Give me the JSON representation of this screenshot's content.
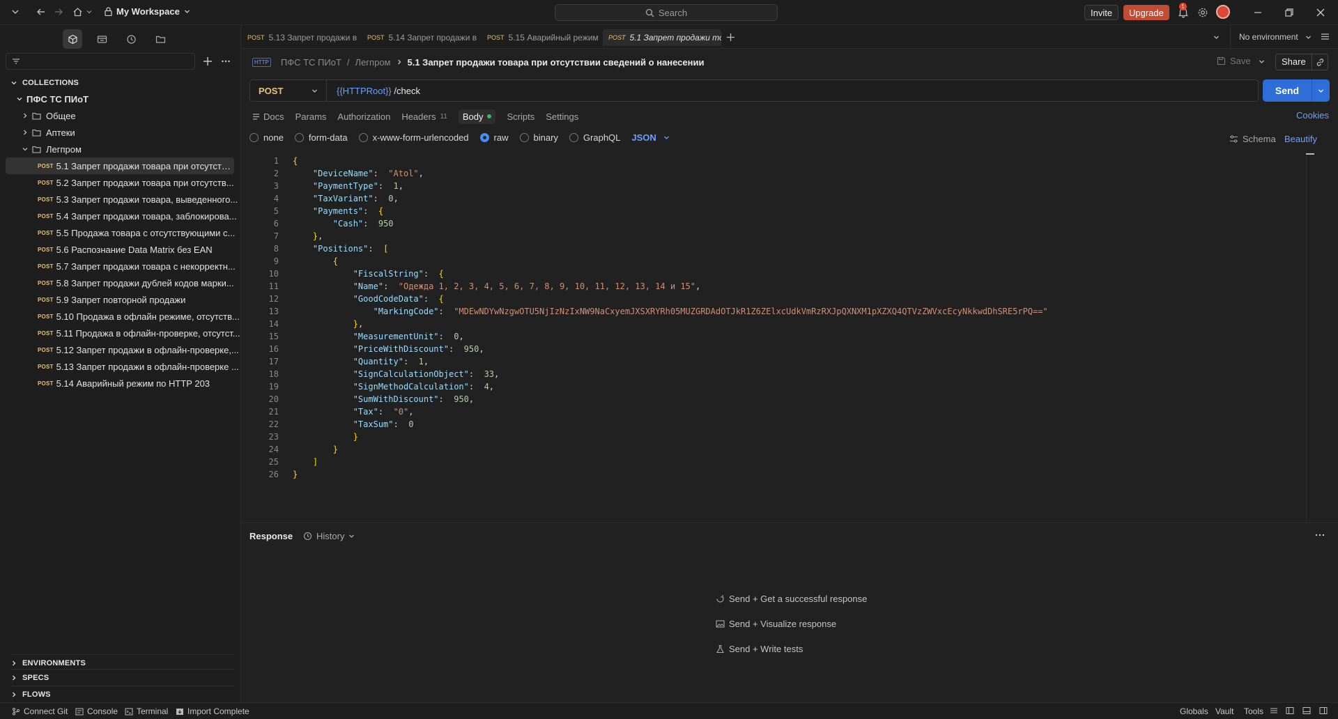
{
  "titlebar": {
    "workspace": "My Workspace",
    "search_placeholder": "Search",
    "invite": "Invite",
    "upgrade": "Upgrade",
    "notification_count": "1"
  },
  "sidebar": {
    "collections_label": "COLLECTIONS",
    "root": "ПФС ТС ПИоТ",
    "folders": [
      "Общее",
      "Аптеки",
      "Легпром"
    ],
    "requests": [
      {
        "method": "POST",
        "label": "5.1 Запрет продажи товара при отсутстви..."
      },
      {
        "method": "POST",
        "label": "5.2 Запрет продажи товара при отсутств..."
      },
      {
        "method": "POST",
        "label": "5.3 Запрет продажи товара, выведенного..."
      },
      {
        "method": "POST",
        "label": "5.4 Запрет продажи товара, заблокирова..."
      },
      {
        "method": "POST",
        "label": "5.5 Продажа товара с отсутствующими с..."
      },
      {
        "method": "POST",
        "label": "5.6 Распознание Data Matrix без EAN"
      },
      {
        "method": "POST",
        "label": "5.7 Запрет продажи товара с некорректн..."
      },
      {
        "method": "POST",
        "label": "5.8 Запрет продажи дублей кодов марки..."
      },
      {
        "method": "POST",
        "label": "5.9 Запрет повторной продажи"
      },
      {
        "method": "POST",
        "label": "5.10 Продажа в офлайн режиме, отсутств..."
      },
      {
        "method": "POST",
        "label": "5.11 Продажа в офлайн-проверке, отсутст..."
      },
      {
        "method": "POST",
        "label": "5.12 Запрет продажи в офлайн-проверке,..."
      },
      {
        "method": "POST",
        "label": "5.13 Запрет продажи в офлайн-проверке ..."
      },
      {
        "method": "POST",
        "label": "5.14 Аварийный режим по HTTP 203"
      }
    ],
    "environments_label": "ENVIRONMENTS",
    "specs_label": "SPECS",
    "flows_label": "FLOWS"
  },
  "tabs": [
    {
      "method": "POST",
      "label": "5.13 Запрет продажи в"
    },
    {
      "method": "POST",
      "label": "5.14 Запрет продажи в"
    },
    {
      "method": "POST",
      "label": "5.15 Аварийный режим"
    },
    {
      "method": "POST",
      "label": "5.1 Запрет продажи то"
    }
  ],
  "environment": "No environment",
  "request": {
    "crumb_icon": "HTTP",
    "crumb_collection": "ПФС ТС ПИоТ",
    "crumb_folder": "Легпром",
    "crumb_title": "5.1 Запрет продажи товара при отсутствии сведений о нанесении",
    "save_label": "Save",
    "share_label": "Share",
    "method": "POST",
    "url_var": "{{HTTPRoot}}",
    "url_path": " /check",
    "send_label": "Send",
    "tabs": {
      "docs": "Docs",
      "params": "Params",
      "auth": "Authorization",
      "headers": "Headers",
      "headers_count": "11",
      "body": "Body",
      "scripts": "Scripts",
      "settings": "Settings"
    },
    "cookies": "Cookies",
    "body_types": [
      "none",
      "form-data",
      "x-www-form-urlencoded",
      "raw",
      "binary",
      "GraphQL"
    ],
    "body_format": "JSON",
    "schema_label": "Schema",
    "beautify_label": "Beautify"
  },
  "response": {
    "title": "Response",
    "history": "History",
    "hints": [
      "Send + Get a successful response",
      "Send + Visualize response",
      "Send + Write tests"
    ]
  },
  "statusbar": {
    "connect_git": "Connect Git",
    "console": "Console",
    "terminal": "Terminal",
    "import": "Import Complete",
    "globals": "Globals",
    "vault": "Vault",
    "tools": "Tools"
  },
  "colors": {
    "accent": "#2d6ed9",
    "upgrade": "#c24b33",
    "method_post": "#e6c07b"
  }
}
